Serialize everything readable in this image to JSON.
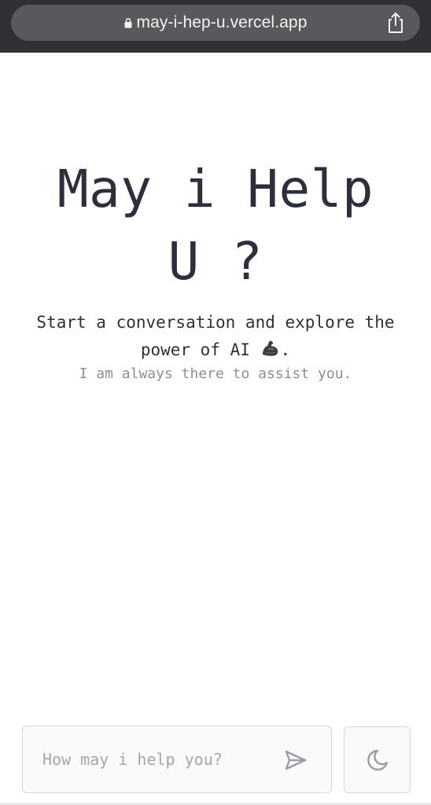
{
  "browser": {
    "url": "may-i-hep-u.vercel.app",
    "lock_icon": "lock-icon",
    "share_icon": "share-icon"
  },
  "hero": {
    "title_line1": "May i Help",
    "title_line2": "U ?",
    "subtitle_line1": "Start a conversation and explore the",
    "subtitle_line2_prefix": "power of AI ",
    "subtitle_icon": "flexed-biceps-icon",
    "subtitle_line2_suffix": ".",
    "tagline": "I am always there to assist you."
  },
  "composer": {
    "placeholder": "How may i help you?",
    "value": "",
    "send_icon": "send-icon",
    "theme_icon": "moon-icon"
  },
  "colors": {
    "text_primary": "#2e2f3d",
    "text_muted": "#8d8e95",
    "border": "#d6d7dc",
    "browser_bar": "#2f3134",
    "icon": "#9a9aa8"
  }
}
